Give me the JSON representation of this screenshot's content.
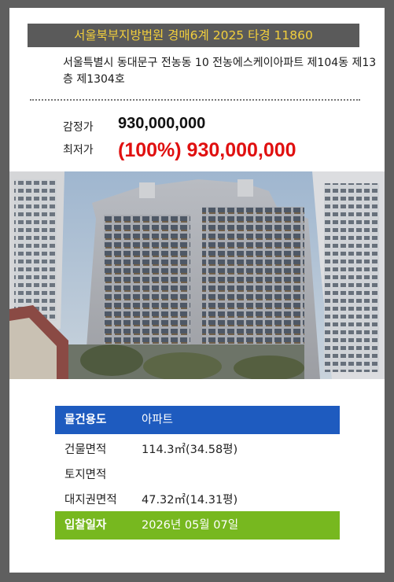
{
  "header": {
    "title": "서울북부지방법원 경매6계 2025 타경 11860",
    "address": "서울특별시 동대문구 전농동 10 전농에스케이아파트 제104동 제13층 제1304호"
  },
  "prices": {
    "appraisal_label": "감정가",
    "appraisal_value": "930,000,000",
    "minimum_label": "최저가",
    "minimum_value": "(100%) 930,000,000"
  },
  "photo": {
    "icon": "apartment-building-photo"
  },
  "info": {
    "usage_label": "물건용도",
    "usage_value": "아파트",
    "building_area_label": "건물면적",
    "building_area_value": "114.3㎡(34.58평)",
    "land_area_label": "토지면적",
    "land_area_value": "",
    "land_right_label": "대지권면적",
    "land_right_value": "47.32㎡(14.31평)",
    "bid_date_label": "입찰일자",
    "bid_date_value": "2026년 05월 07일"
  },
  "colors": {
    "title_bg": "#5a5a5a",
    "title_text": "#f2cf3c",
    "minimum_price": "#e01010",
    "usage_row_bg": "#1e5bbf",
    "bid_row_bg": "#77b81f"
  }
}
